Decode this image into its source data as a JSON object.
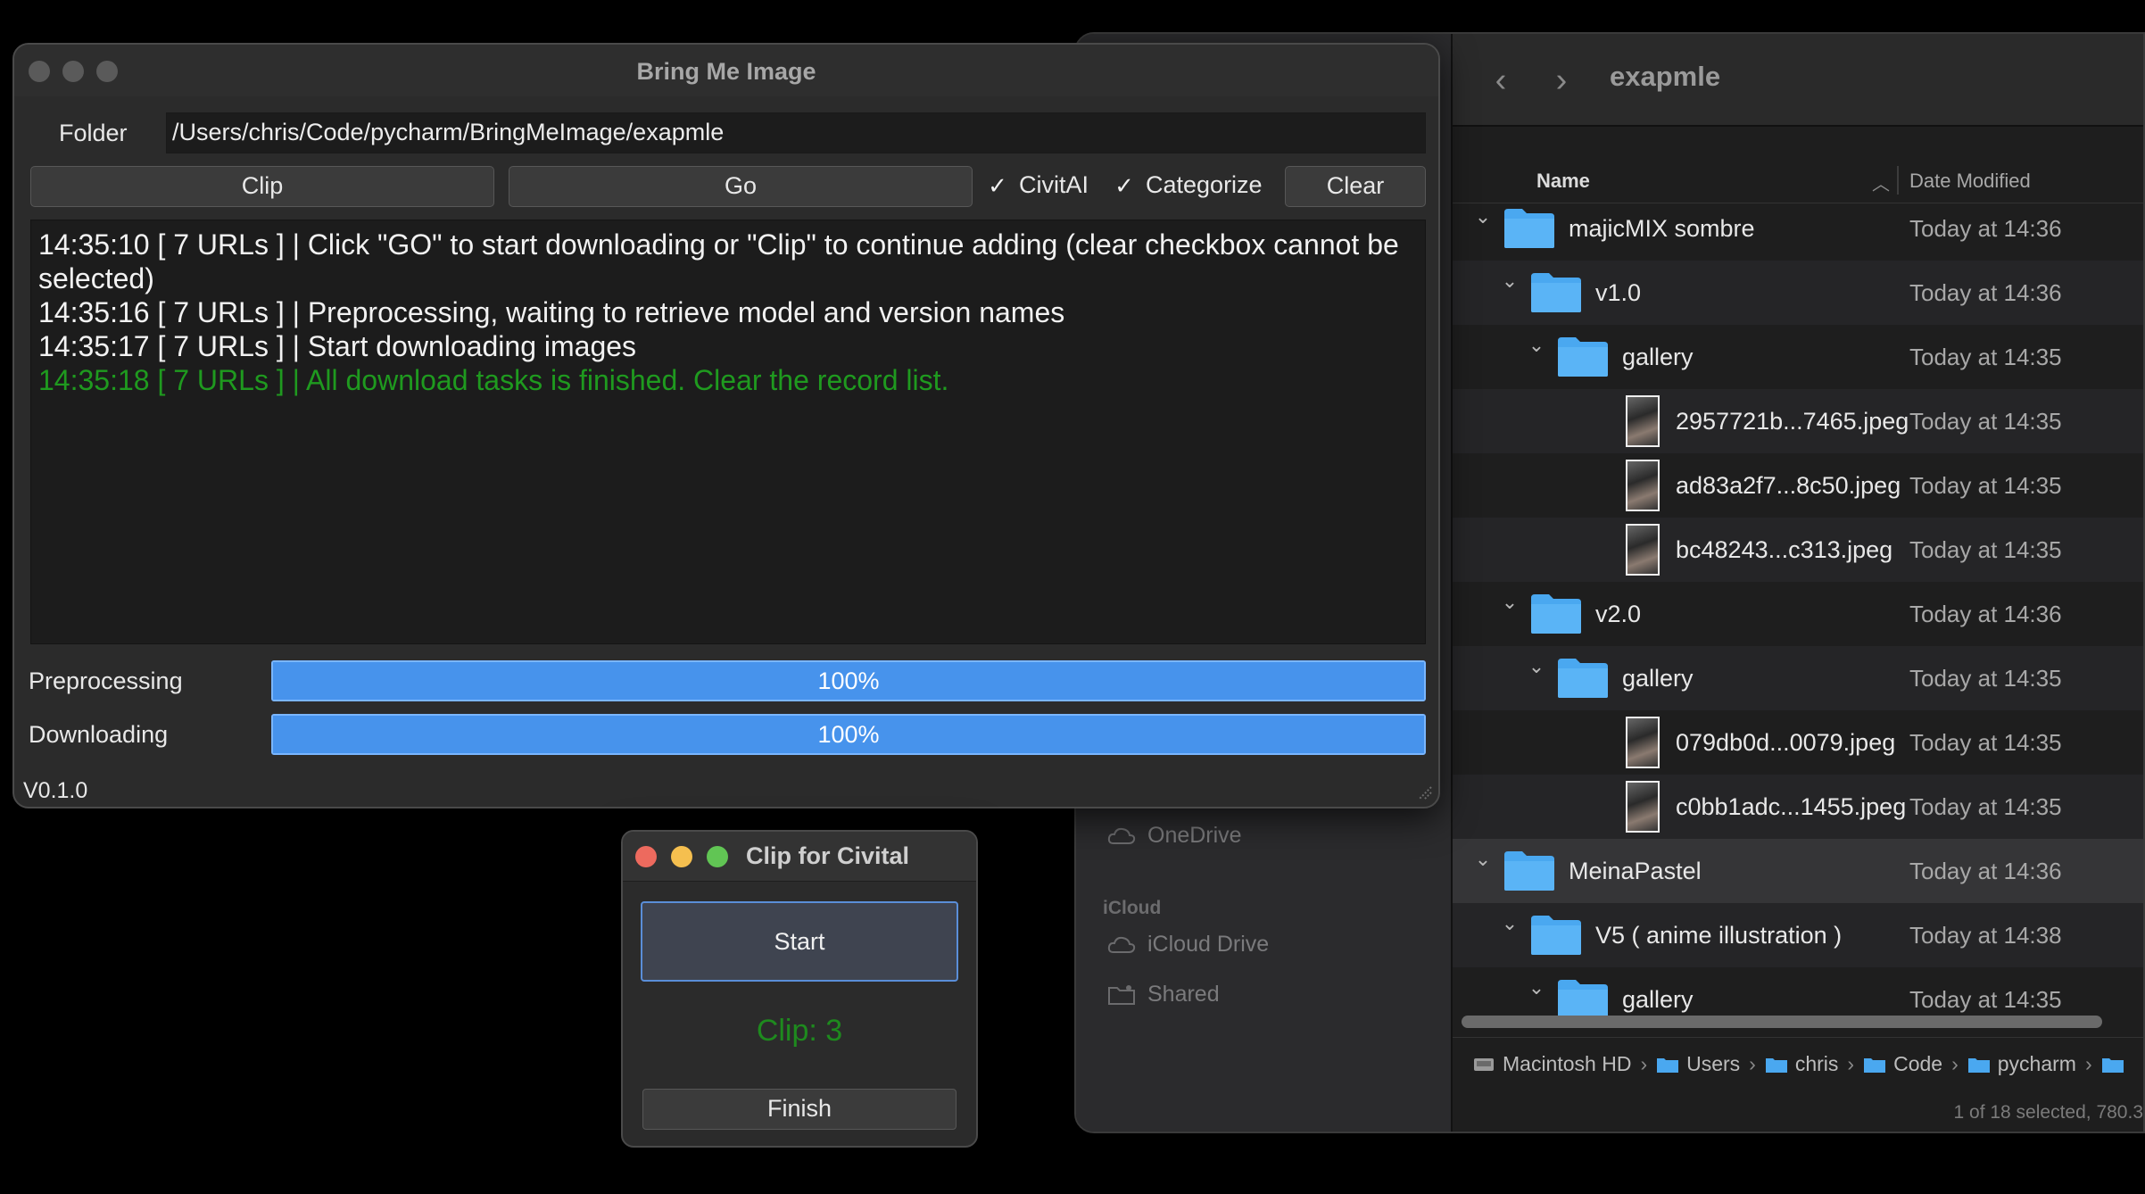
{
  "finder": {
    "title": "exapmle",
    "columns": {
      "name": "Name",
      "date": "Date Modified"
    },
    "sidebar": {
      "onedrive": "OneDrive",
      "icloud_section": "iCloud",
      "icloud_drive": "iCloud Drive",
      "shared": "Shared"
    },
    "rows": [
      {
        "name": "majicMIX sombre",
        "date": "Today at 14:36",
        "kind": "folder",
        "level": 0
      },
      {
        "name": "v1.0",
        "date": "Today at 14:36",
        "kind": "folder",
        "level": 1
      },
      {
        "name": "gallery",
        "date": "Today at 14:35",
        "kind": "folder",
        "level": 2
      },
      {
        "name": "2957721b...7465.jpeg",
        "date": "Today at 14:35",
        "kind": "image",
        "level": 3
      },
      {
        "name": "ad83a2f7...8c50.jpeg",
        "date": "Today at 14:35",
        "kind": "image",
        "level": 3
      },
      {
        "name": "bc48243...c313.jpeg",
        "date": "Today at 14:35",
        "kind": "image",
        "level": 3
      },
      {
        "name": "v2.0",
        "date": "Today at 14:36",
        "kind": "folder",
        "level": 1
      },
      {
        "name": "gallery",
        "date": "Today at 14:35",
        "kind": "folder",
        "level": 2
      },
      {
        "name": "079db0d...0079.jpeg",
        "date": "Today at 14:35",
        "kind": "image",
        "level": 3
      },
      {
        "name": "c0bb1adc...1455.jpeg",
        "date": "Today at 14:35",
        "kind": "image",
        "level": 3
      },
      {
        "name": "MeinaPastel",
        "date": "Today at 14:36",
        "kind": "folder",
        "level": 0
      },
      {
        "name": "V5 ( anime illustration )",
        "date": "Today at 14:38",
        "kind": "folder",
        "level": 1
      },
      {
        "name": "gallery",
        "date": "Today at 14:35",
        "kind": "folder",
        "level": 2
      }
    ],
    "path": [
      "Macintosh HD",
      "Users",
      "chris",
      "Code",
      "pycharm"
    ],
    "status": "1 of 18 selected, 780.3"
  },
  "bmi": {
    "title": "Bring Me Image",
    "folder_label": "Folder",
    "folder_value": "/Users/chris/Code/pycharm/BringMeImage/exapmle",
    "clip_btn": "Clip",
    "go_btn": "Go",
    "civitai_label": "CivitAI",
    "civitai_checked": true,
    "categorize_label": "Categorize",
    "categorize_checked": true,
    "clear_btn": "Clear",
    "log": [
      {
        "text": "14:35:10 [ 7 URLs ] | Click \"GO\" to start downloading or \"Clip\" to continue adding (clear checkbox cannot be selected)",
        "color": "#f2f2f2"
      },
      {
        "text": "14:35:16 [ 7 URLs ] | Preprocessing, waiting to retrieve model and version names",
        "color": "#f2f2f2"
      },
      {
        "text": "14:35:17 [ 7 URLs ] | Start downloading images",
        "color": "#f2f2f2"
      },
      {
        "text": "14:35:18 [ 7 URLs ] | All download tasks is finished. Clear the record list.",
        "color": "#1f9a1f"
      }
    ],
    "preprocessing_label": "Preprocessing",
    "preprocessing_text": "100%",
    "preprocessing_value": 100,
    "downloading_label": "Downloading",
    "downloading_text": "100%",
    "downloading_value": 100,
    "version": "V0.1.0"
  },
  "clip": {
    "title": "Clip for Civital",
    "start_btn": "Start",
    "count_text": "Clip: 3",
    "finish_btn": "Finish"
  },
  "colors": {
    "accent_blue": "#3d8de8",
    "success_green": "#1f9a1f",
    "traffic_red": "#ed6a5e",
    "traffic_yellow": "#f5bf4f",
    "traffic_green": "#61c554",
    "folder_blue": "#4aa8f0"
  }
}
